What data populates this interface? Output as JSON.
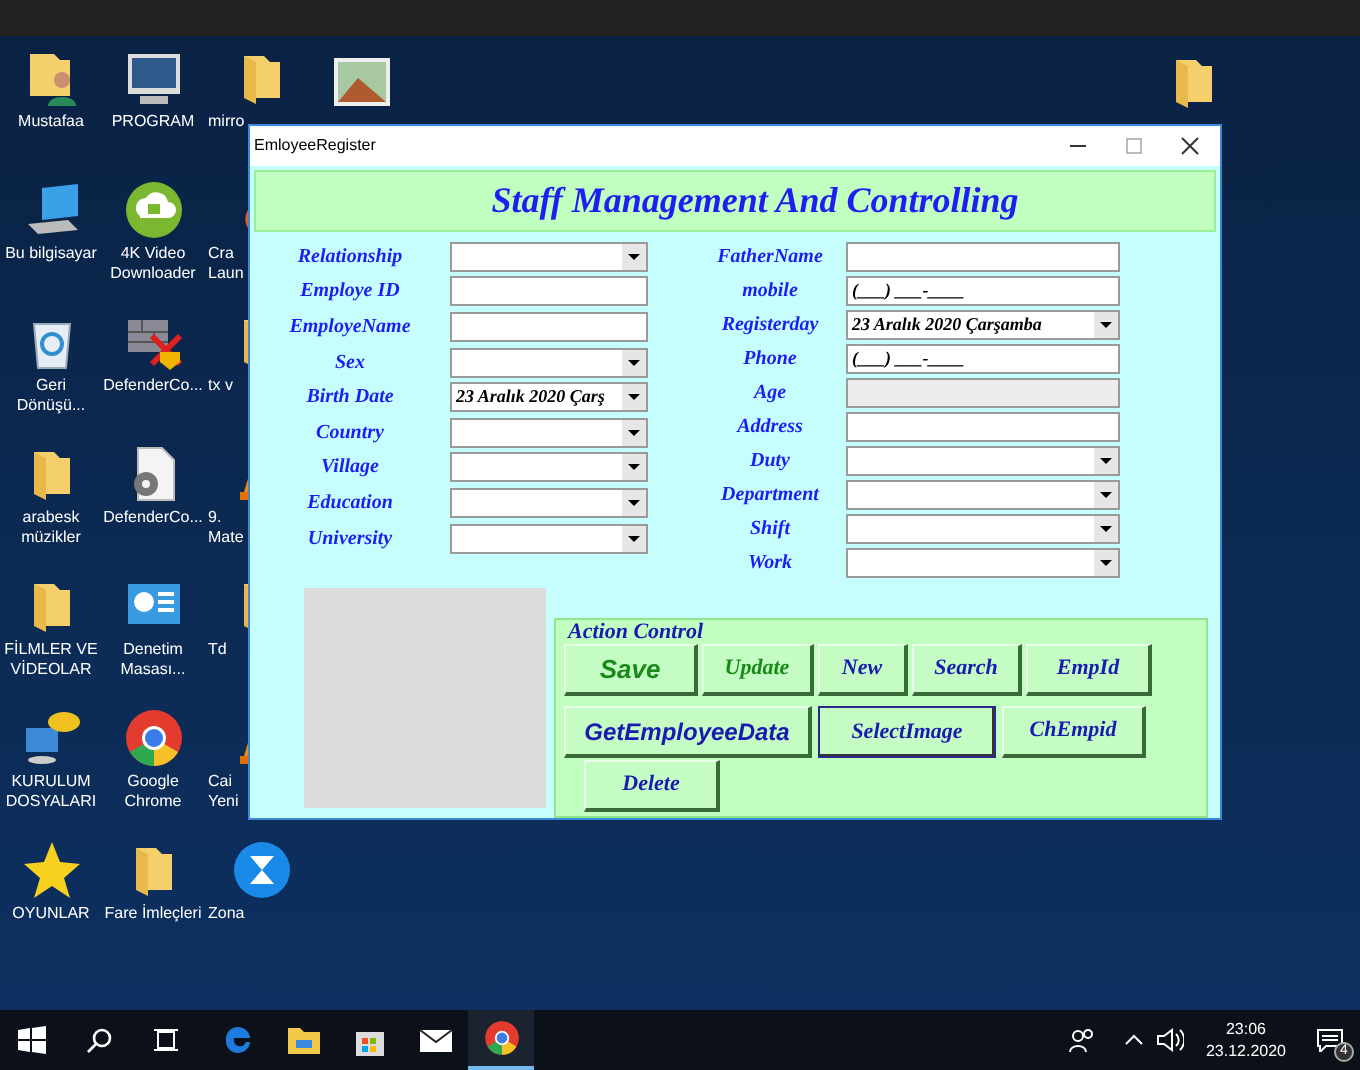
{
  "desktop": {
    "columns": [
      [
        {
          "label": "Mustafaa",
          "kind": "userfolder"
        },
        {
          "label": "Bu bilgisayar",
          "kind": "computer"
        },
        {
          "label": "Geri Dönüşü...",
          "kind": "recycle"
        },
        {
          "label": "arabesk müzikler",
          "kind": "folder"
        },
        {
          "label": "FİLMLER VE VİDEOLAR",
          "kind": "folder"
        },
        {
          "label": "KURULUM DOSYALARI",
          "kind": "help"
        },
        {
          "label": "OYUNLAR",
          "kind": "star"
        }
      ],
      [
        {
          "label": "PROGRAM",
          "kind": "monitor"
        },
        {
          "label": "4K Video Downloader",
          "kind": "download"
        },
        {
          "label": "DefenderCo...",
          "kind": "shield"
        },
        {
          "label": "DefenderCo...",
          "kind": "gearfile"
        },
        {
          "label": "Denetim Masası...",
          "kind": "panel"
        },
        {
          "label": "Google Chrome",
          "kind": "chrome"
        },
        {
          "label": "Fare İmleçleri",
          "kind": "folder"
        }
      ],
      [
        {
          "label": "mirro",
          "kind": "folder"
        },
        {
          "label": "Cra Laun",
          "kind": "fire"
        },
        {
          "label": "tx v",
          "kind": "folder"
        },
        {
          "label": "9. Mate",
          "kind": "cone"
        },
        {
          "label": "Td",
          "kind": "folder"
        },
        {
          "label": "Cai Yeni",
          "kind": "cone"
        },
        {
          "label": "Zona",
          "kind": "zona"
        }
      ]
    ],
    "extra_icons": [
      {
        "kind": "picture"
      },
      {
        "kind": "folder"
      }
    ]
  },
  "window": {
    "title": "EmloyeeRegister",
    "heading": "Staff Management And Controlling",
    "left_fields": [
      {
        "label": "Relationship",
        "kind": "combo"
      },
      {
        "label": "Employe ID",
        "kind": "text"
      },
      {
        "label": "EmployeName",
        "kind": "text"
      },
      {
        "label": "Sex",
        "kind": "combo"
      },
      {
        "label": "Birth Date",
        "kind": "combo",
        "value": "23  Aralık  2020 Çarş"
      },
      {
        "label": "Country",
        "kind": "combo"
      },
      {
        "label": "Village",
        "kind": "combo"
      },
      {
        "label": "Education",
        "kind": "combo"
      },
      {
        "label": "University",
        "kind": "combo"
      }
    ],
    "right_fields": [
      {
        "label": "FatherName",
        "kind": "text"
      },
      {
        "label": "mobile",
        "kind": "text",
        "value": "(___) ___-____"
      },
      {
        "label": "Registerday",
        "kind": "combo",
        "value": "23  Aralık  2020 Çarşamba"
      },
      {
        "label": "Phone",
        "kind": "text",
        "value": "(___) ___-____"
      },
      {
        "label": "Age",
        "kind": "readonly"
      },
      {
        "label": "Address",
        "kind": "text"
      },
      {
        "label": "Duty",
        "kind": "combo"
      },
      {
        "label": "Department",
        "kind": "combo"
      },
      {
        "label": "Shift",
        "kind": "combo"
      },
      {
        "label": "Work",
        "kind": "combo"
      }
    ],
    "action_group": {
      "title": "Action Control",
      "buttons": [
        {
          "label": "Save",
          "kind": "greensans",
          "focused": false
        },
        {
          "label": "Update",
          "kind": "greenserif",
          "focused": false
        },
        {
          "label": "New",
          "kind": "blueserif",
          "focused": false
        },
        {
          "label": "Search",
          "kind": "blueserif",
          "focused": false
        },
        {
          "label": "EmpId",
          "kind": "blueserif",
          "focused": false
        },
        {
          "label": "GetEmployeeData",
          "kind": "bluesans",
          "focused": false
        },
        {
          "label": "SelectImage",
          "kind": "blueserif",
          "focused": true
        },
        {
          "label": "ChEmpid",
          "kind": "blueserif",
          "focused": false
        },
        {
          "label": "Delete",
          "kind": "blueserif",
          "focused": false
        }
      ]
    }
  },
  "taskbar": {
    "apps": [
      {
        "kind": "edge",
        "active": false
      },
      {
        "kind": "explorer",
        "active": false
      },
      {
        "kind": "store",
        "active": false
      },
      {
        "kind": "mail",
        "active": false
      },
      {
        "kind": "chrome",
        "active": true
      }
    ],
    "time": "23:06",
    "date": "23.12.2020",
    "notifications": "4"
  }
}
